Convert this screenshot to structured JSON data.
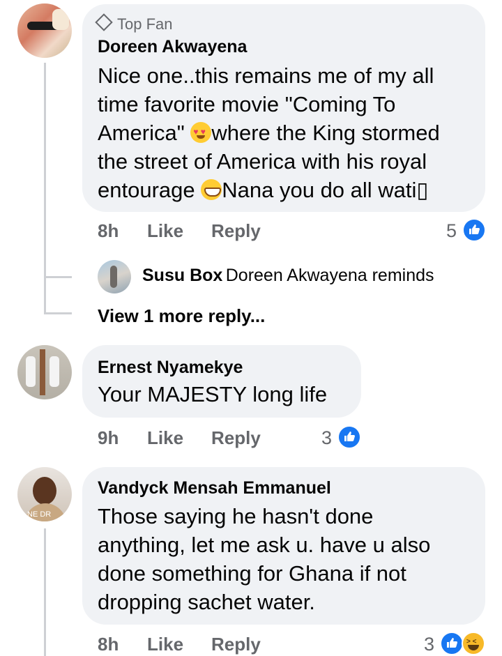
{
  "comments": [
    {
      "badge": "Top Fan",
      "author": "Doreen Akwayena",
      "lines": [
        "Nice one..this remains me of my all",
        "time favorite movie \"Coming To",
        "America\"",
        "where the King stormed",
        "the street of America with his royal",
        "entourage",
        "Nana you do all wati▯"
      ],
      "time": "8h",
      "like": "Like",
      "reply": "Reply",
      "reactions": "5",
      "replies_preview": {
        "author": "Susu Box",
        "snippet": "Doreen Akwayena reminds"
      },
      "view_more": "View 1 more reply..."
    },
    {
      "author": "Ernest Nyamekye",
      "text": "Your MAJESTY long life",
      "time": "9h",
      "like": "Like",
      "reply": "Reply",
      "reactions": "3"
    },
    {
      "author": "Vandyck Mensah Emmanuel",
      "lines": [
        "Those saying he hasn't done",
        "anything, let me ask u. have u also",
        "done something for Ghana if not",
        "dropping sachet water."
      ],
      "time": "8h",
      "like": "Like",
      "reply": "Reply",
      "reactions": "3"
    }
  ],
  "colors": {
    "bubble": "#f0f2f5",
    "meta": "#65676b",
    "like_blue": "#1877f2",
    "thread_line": "#ced0d4"
  },
  "icons": {
    "top_fan": "diamond-badge-icon",
    "like_reaction": "thumbs-up-icon",
    "haha_reaction": "laughing-face-icon",
    "heart_eyes_emoji": "heart-eyes-emoji",
    "grin_emoji": "grinning-emoji"
  },
  "avatar_text": {
    "vandyck": "NE DR"
  }
}
